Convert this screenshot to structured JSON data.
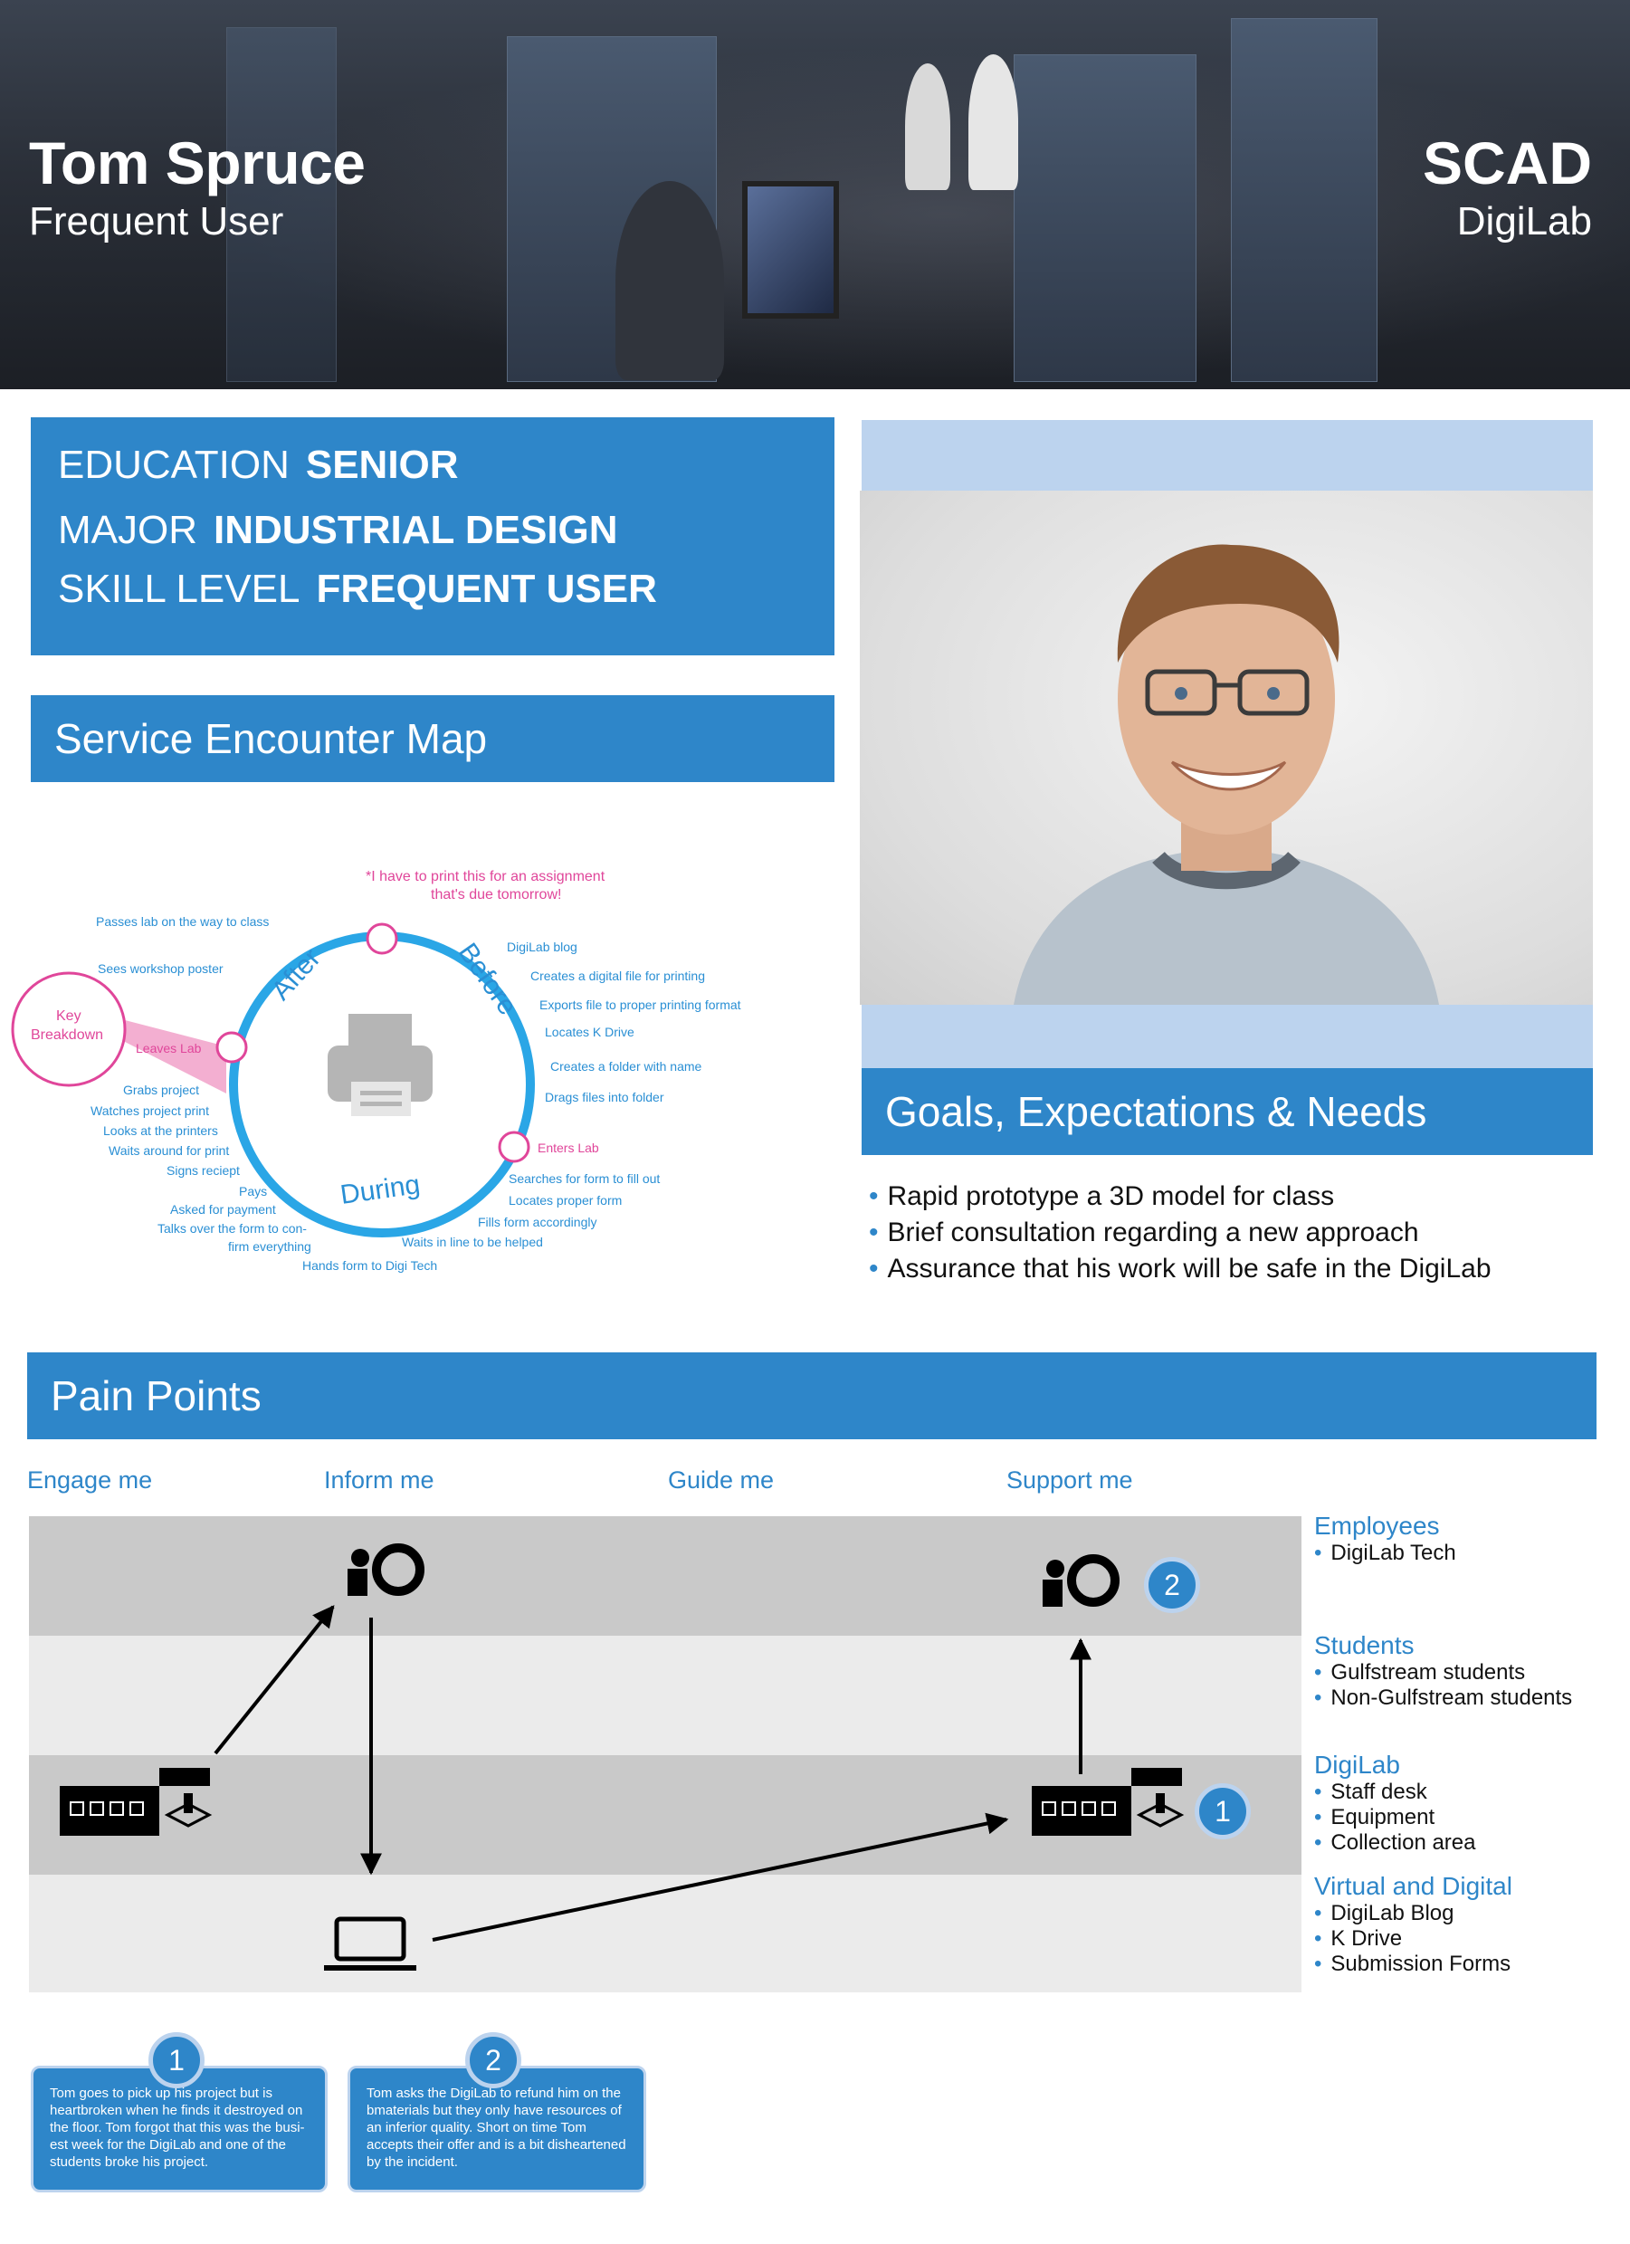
{
  "header": {
    "name": "Tom Spruce",
    "role": "Frequent User",
    "brand": "SCAD",
    "brand_sub": "DigiLab"
  },
  "profile": [
    {
      "key": "EDUCATION",
      "value": "SENIOR"
    },
    {
      "key": "MAJOR",
      "value": "INDUSTRIAL DESIGN"
    },
    {
      "key": "SKILL LEVEL",
      "value": "FREQUENT USER"
    }
  ],
  "sections": {
    "service_map": "Service Encounter Map",
    "goals": "Goals, Expectations & Needs",
    "pain_points": "Pain Points"
  },
  "goals": [
    "Rapid prototype a 3D model for class",
    "Brief consultation regarding a new approach",
    "Assurance that his work will be safe in the DigiLab"
  ],
  "map": {
    "quote": "*I have to print this for an assignment",
    "quote2": "that's due tomorrow!",
    "phases": {
      "after": "After",
      "before": "Before",
      "during": "During"
    },
    "key_breakdown": [
      "Key",
      "Breakdown"
    ],
    "before_steps": [
      "DigiLab blog",
      "Creates a digital file for printing",
      "Exports file to proper printing format",
      "Locates K Drive",
      "Creates a folder with name",
      "Drags files into folder"
    ],
    "enters_lab": "Enters Lab",
    "during_steps": [
      "Searches for form to fill out",
      "Locates proper form",
      "Fills form accordingly",
      "Waits in line to be helped",
      "Hands form to Digi Tech"
    ],
    "after_steps": [
      "Passes lab on the way to class",
      "Sees workshop poster",
      "Leaves Lab",
      "Grabs project",
      "Watches project print",
      "Looks at the printers",
      "Waits around for print",
      "Signs reciept",
      "Pays",
      "Asked for payment",
      "Talks over the form to con-",
      "firm everything"
    ]
  },
  "stages": [
    "Engage me",
    "Inform me",
    "Guide me",
    "Support me"
  ],
  "legend": [
    {
      "title": "Employees",
      "items": [
        "DigiLab Tech"
      ]
    },
    {
      "title": "Students",
      "items": [
        "Gulfstream students",
        "Non-Gulfstream students"
      ]
    },
    {
      "title": "DigiLab",
      "items": [
        "Staff desk",
        "Equipment",
        "Collection area"
      ]
    },
    {
      "title": "Virtual and Digital",
      "items": [
        "DigiLab Blog",
        "K Drive",
        "Submission Forms"
      ]
    }
  ],
  "markers": [
    "1",
    "2"
  ],
  "notes": [
    {
      "num": "1",
      "lines": [
        "Tom goes to pick up his project but is",
        "heartbroken when he finds it destroyed on",
        "the floor. Tom forgot that this was the busi-",
        "est week for the DigiLab and one of the",
        "students broke his project."
      ]
    },
    {
      "num": "2",
      "lines": [
        "Tom asks the DigiLab to refund him on the",
        "bmaterials but they only have resources of",
        "an inferior quality. Short on time Tom",
        "accepts their offer and is a bit disheartened",
        "by the incident."
      ]
    }
  ],
  "colors": {
    "accent": "#2e86c9",
    "accent_light": "#bcd3ee",
    "pink": "#e0469a",
    "map_blue": "#2a8fd4"
  }
}
